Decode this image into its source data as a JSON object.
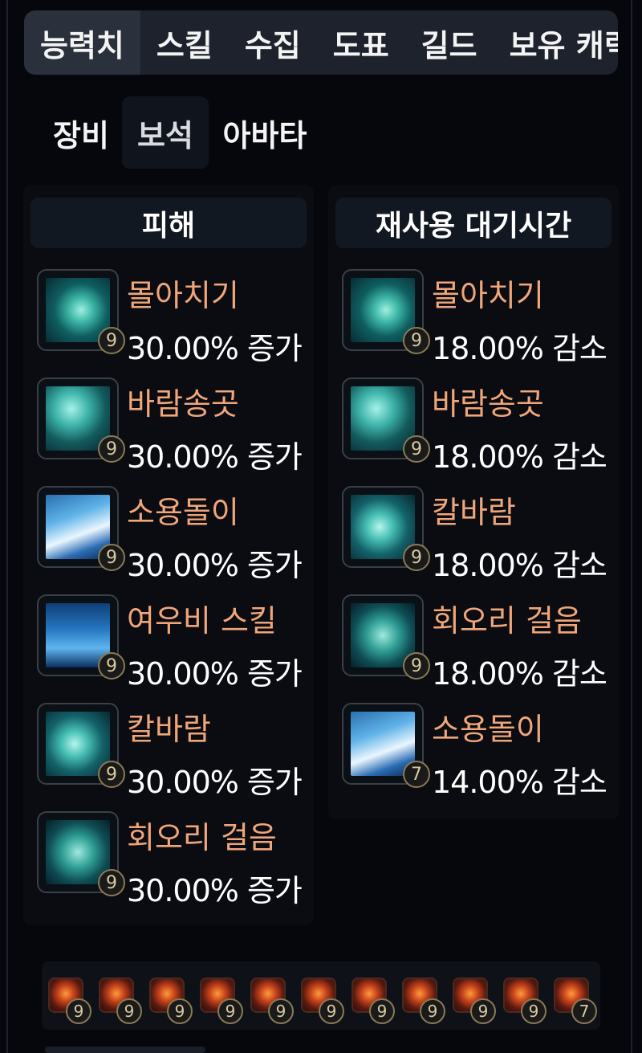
{
  "top_tabs": [
    "능력치",
    "스킬",
    "수집",
    "도표",
    "길드",
    "보유 캐릭"
  ],
  "sub_tabs": [
    "장비",
    "보석",
    "아바타"
  ],
  "damage_panel": {
    "title": "피해",
    "gems": [
      {
        "name": "몰아치기",
        "value": "30.00% 증가",
        "level": "9",
        "art": "swirl-teal"
      },
      {
        "name": "바람송곳",
        "value": "30.00% 증가",
        "level": "9",
        "art": "umbrella-teal"
      },
      {
        "name": "소용돌이",
        "value": "30.00% 증가",
        "level": "9",
        "art": "wave-blue"
      },
      {
        "name": "여우비 스킬",
        "value": "30.00% 증가",
        "level": "9",
        "art": "rain-blue"
      },
      {
        "name": "칼바람",
        "value": "30.00% 증가",
        "level": "9",
        "art": "slash-teal"
      },
      {
        "name": "회오리 걸음",
        "value": "30.00% 증가",
        "level": "9",
        "art": "whirl-teal"
      }
    ]
  },
  "cooldown_panel": {
    "title": "재사용 대기시간",
    "gems": [
      {
        "name": "몰아치기",
        "value": "18.00% 감소",
        "level": "9",
        "art": "swirl-teal"
      },
      {
        "name": "바람송곳",
        "value": "18.00% 감소",
        "level": "9",
        "art": "umbrella-teal"
      },
      {
        "name": "칼바람",
        "value": "18.00% 감소",
        "level": "9",
        "art": "slash-teal"
      },
      {
        "name": "회오리 걸음",
        "value": "18.00% 감소",
        "level": "9",
        "art": "whirl-teal"
      },
      {
        "name": "소용돌이",
        "value": "14.00% 감소",
        "level": "7",
        "art": "wave-blue"
      }
    ]
  },
  "gem_strip": [
    "9",
    "9",
    "9",
    "9",
    "9",
    "9",
    "9",
    "9",
    "9",
    "9",
    "7"
  ],
  "colors": {
    "gem_name": "#f0a678",
    "value_text": "#ffffff",
    "panel_bg": "#0a0c12",
    "header_bg": "#121822",
    "tab_bar_bg": "#1d222c",
    "level_border": "#8a7a55"
  }
}
